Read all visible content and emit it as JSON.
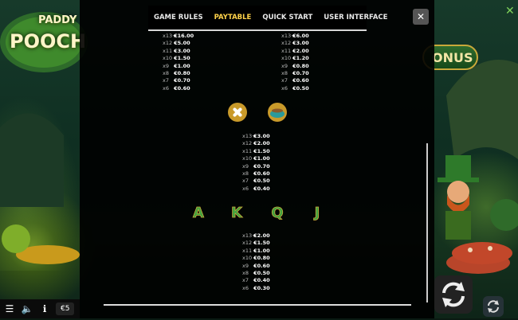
{
  "logo": {
    "line1": "PADDY",
    "line2": "POOCH"
  },
  "bonus_label": "ONUS",
  "tabs": [
    {
      "label": "GAME RULES",
      "active": false
    },
    {
      "label": "PAYTABLE",
      "active": true
    },
    {
      "label": "QUICK START",
      "active": false
    },
    {
      "label": "USER INTERFACE",
      "active": false
    }
  ],
  "close_label": "✕",
  "paytables": {
    "top_left": [
      {
        "x": "x13+",
        "v": "€16.00"
      },
      {
        "x": "x12",
        "v": "€5.00"
      },
      {
        "x": "x11",
        "v": "€3.00"
      },
      {
        "x": "x10",
        "v": "€1.50"
      },
      {
        "x": "x9",
        "v": "€1.00"
      },
      {
        "x": "x8",
        "v": "€0.80"
      },
      {
        "x": "x7",
        "v": "€0.70"
      },
      {
        "x": "x6",
        "v": "€0.60"
      }
    ],
    "top_right": [
      {
        "x": "x13+",
        "v": "€6.00"
      },
      {
        "x": "x12",
        "v": "€3.00"
      },
      {
        "x": "x11",
        "v": "€2.00"
      },
      {
        "x": "x10",
        "v": "€1.20"
      },
      {
        "x": "x9",
        "v": "€0.80"
      },
      {
        "x": "x8",
        "v": "€0.70"
      },
      {
        "x": "x7",
        "v": "€0.60"
      },
      {
        "x": "x6",
        "v": "€0.50"
      }
    ],
    "middle": [
      {
        "x": "x13+",
        "v": "€3.00"
      },
      {
        "x": "x12",
        "v": "€2.00"
      },
      {
        "x": "x11",
        "v": "€1.50"
      },
      {
        "x": "x10",
        "v": "€1.00"
      },
      {
        "x": "x9",
        "v": "€0.70"
      },
      {
        "x": "x8",
        "v": "€0.60"
      },
      {
        "x": "x7",
        "v": "€0.50"
      },
      {
        "x": "x6",
        "v": "€0.40"
      }
    ],
    "bottom": [
      {
        "x": "x13+",
        "v": "€2.00"
      },
      {
        "x": "x12",
        "v": "€1.50"
      },
      {
        "x": "x11",
        "v": "€1.00"
      },
      {
        "x": "x10",
        "v": "€0.80"
      },
      {
        "x": "x9",
        "v": "€0.60"
      },
      {
        "x": "x8",
        "v": "€0.50"
      },
      {
        "x": "x7",
        "v": "€0.40"
      },
      {
        "x": "x6",
        "v": "€0.30"
      }
    ]
  },
  "symbols": {
    "middle": [
      "bone-symbol-icon",
      "food-bowl-symbol-icon"
    ],
    "bottom": [
      "A",
      "K",
      "Q",
      "J"
    ]
  },
  "bottom_bar": {
    "amount": "€5"
  },
  "colors": {
    "active_tab": "#ffd24a",
    "overlay": "#000000"
  }
}
